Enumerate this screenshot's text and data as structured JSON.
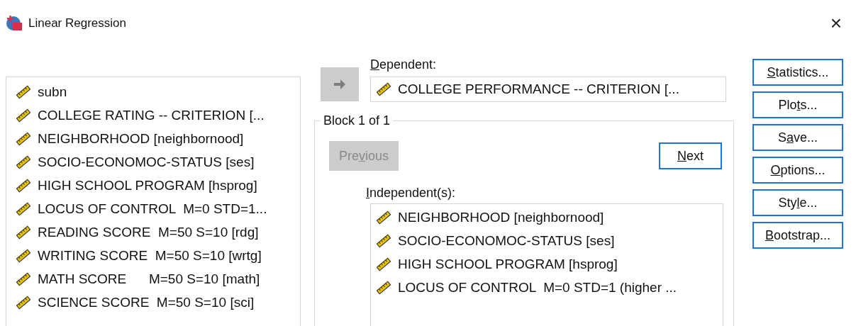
{
  "window": {
    "title": "Linear Regression",
    "close": "×"
  },
  "variables": [
    {
      "name": "subn"
    },
    {
      "name": "COLLEGE RATING -- CRITERION [..."
    },
    {
      "name": "NEIGHBORHOOD [neighbornood]"
    },
    {
      "name": "SOCIO-ECONOMOC-STATUS [ses]"
    },
    {
      "name": "HIGH SCHOOL PROGRAM [hsprog]"
    },
    {
      "name": "LOCUS OF CONTROL  M=0 STD=1..."
    },
    {
      "name": "READING SCORE  M=50 S=10 [rdg]"
    },
    {
      "name": "WRITING SCORE  M=50 S=10 [wrtg]"
    },
    {
      "name": "MATH SCORE      M=50 S=10 [math]"
    },
    {
      "name": "SCIENCE SCORE  M=50 S=10 [sci]"
    }
  ],
  "move_button": {
    "disabled": true
  },
  "dependent": {
    "label": {
      "key": "D",
      "rest": "ependent:"
    },
    "value": "COLLEGE PERFORMANCE -- CRITERION [..."
  },
  "block": {
    "title": "Block 1 of 1",
    "previous": {
      "label": {
        "lead": "Pre",
        "key": "v",
        "rest": "ious"
      },
      "disabled": true
    },
    "next": {
      "label": {
        "key": "N",
        "rest": "ext"
      },
      "disabled": false
    },
    "independents_label": {
      "key": "I",
      "rest": "ndependent(s):"
    },
    "independents": [
      {
        "name": "NEIGHBORHOOD [neighbornood]"
      },
      {
        "name": "SOCIO-ECONOMOC-STATUS [ses]"
      },
      {
        "name": "HIGH SCHOOL PROGRAM [hsprog]"
      },
      {
        "name": "LOCUS OF CONTROL  M=0 STD=1 (higher ..."
      }
    ]
  },
  "side_buttons": [
    {
      "key": "S",
      "rest": "tatistics..."
    },
    {
      "lead": "Plo",
      "key": "t",
      "rest": "s..."
    },
    {
      "lead": "S",
      "key": "a",
      "rest": "ve..."
    },
    {
      "key": "O",
      "rest": "ptions..."
    },
    {
      "lead": "Sty",
      "key": "l",
      "rest": "e..."
    },
    {
      "key": "B",
      "rest": "ootstrap..."
    }
  ]
}
